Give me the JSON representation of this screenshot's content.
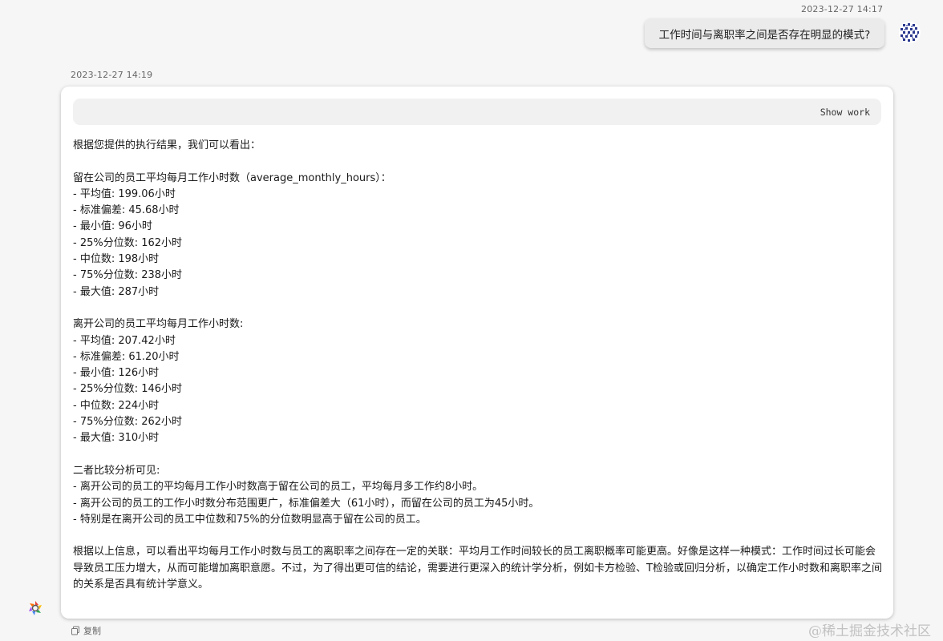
{
  "user_message": {
    "timestamp": "2023-12-27 14:17",
    "text": "工作时间与离职率之间是否存在明显的模式?"
  },
  "assistant_message": {
    "timestamp": "2023-12-27 14:19",
    "show_work_label": "Show work",
    "intro": "根据您提供的执行结果，我们可以看出：",
    "stay": {
      "heading": "留在公司的员工平均每月工作小时数（average_monthly_hours）：",
      "items": [
        "- 平均值: 199.06小时",
        "- 标准偏差: 45.68小时",
        "- 最小值: 96小时",
        "- 25%分位数: 162小时",
        "- 中位数: 198小时",
        "- 75%分位数: 238小时",
        "- 最大值: 287小时"
      ]
    },
    "leave": {
      "heading": "离开公司的员工平均每月工作小时数:",
      "items": [
        "- 平均值: 207.42小时",
        "- 标准偏差: 61.20小时",
        "- 最小值: 126小时",
        "- 25%分位数: 146小时",
        "- 中位数: 224小时",
        "- 75%分位数: 262小时",
        "- 最大值: 310小时"
      ]
    },
    "comparison": {
      "heading": "二者比较分析可见:",
      "items": [
        "- 离开公司的员工的平均每月工作小时数高于留在公司的员工，平均每月多工作约8小时。",
        "- 离开公司的员工的工作小时数分布范围更广，标准偏差大（61小时），而留在公司的员工为45小时。",
        "- 特别是在离开公司的员工中位数和75%的分位数明显高于留在公司的员工。"
      ]
    },
    "conclusion": "根据以上信息，可以看出平均每月工作小时数与员工的离职率之间存在一定的关联：平均月工作时间较长的员工离职概率可能更高。好像是这样一种模式：工作时间过长可能会导致员工压力增大，从而可能增加离职意愿。不过，为了得出更可信的结论，需要进行更深入的统计学分析，例如卡方检验、T检验或回归分析，以确定工作小时数和离职率之间的关系是否具有统计学意义。",
    "copy_label": "复制"
  },
  "watermark": "@稀土掘金技术社区",
  "icons": {
    "avatar": "avatar-pattern-icon",
    "copy": "copy-icon",
    "logo": "app-logo-icon"
  },
  "colors": {
    "background": "#f6f6f6",
    "card": "#ffffff",
    "user_bubble": "#ebebeb",
    "show_work_bar": "#f1f1f1"
  }
}
